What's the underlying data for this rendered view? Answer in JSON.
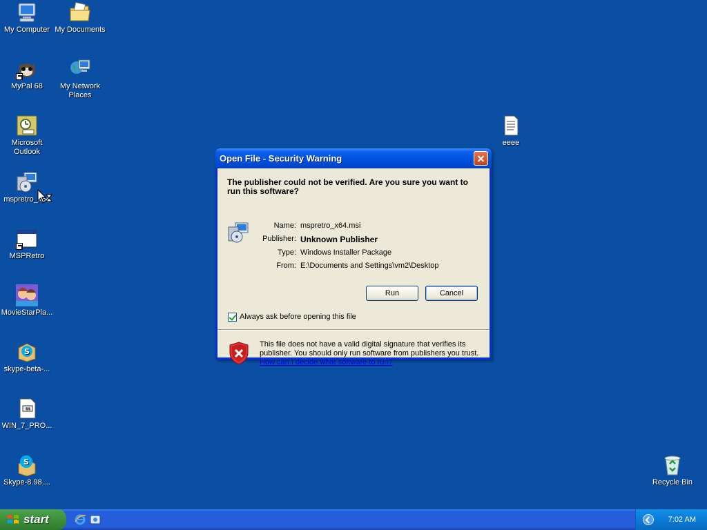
{
  "desktop": {
    "icons": [
      {
        "label": "My Computer",
        "icon": "my-computer-icon"
      },
      {
        "label": "My Documents",
        "icon": "my-documents-icon"
      },
      {
        "label": "MyPal 68",
        "icon": "mypal-icon"
      },
      {
        "label": "My Network Places",
        "icon": "network-places-icon"
      },
      {
        "label": "Microsoft Outlook",
        "icon": "outlook-icon"
      },
      {
        "label": "mspretro_x64",
        "icon": "msi-installer-icon"
      },
      {
        "label": "MSPRetro",
        "icon": "application-icon"
      },
      {
        "label": "MovieStarPla...",
        "icon": "moviestarplanet-icon"
      },
      {
        "label": "skype-beta-...",
        "icon": "skype-installer-icon"
      },
      {
        "label": "WIN_7_PRO...",
        "icon": "iso-file-icon"
      },
      {
        "label": "Skype-8.98....",
        "icon": "skype-installer-icon"
      },
      {
        "label": "eeee",
        "icon": "text-file-icon"
      },
      {
        "label": "Recycle Bin",
        "icon": "recycle-bin-icon"
      }
    ]
  },
  "dialog": {
    "title": "Open File - Security Warning",
    "question": "The publisher could not be verified.  Are you sure you want to run this software?",
    "fields": {
      "name_label": "Name:",
      "name_value": "mspretro_x64.msi",
      "publisher_label": "Publisher:",
      "publisher_value": "Unknown Publisher",
      "type_label": "Type:",
      "type_value": "Windows Installer Package",
      "from_label": "From:",
      "from_value": "E:\\Documents and Settings\\vm2\\Desktop"
    },
    "run_label": "Run",
    "cancel_label": "Cancel",
    "checkbox_label": "Always ask before opening this file",
    "checkbox_checked": true,
    "warning_text": "This file does not have a valid digital signature that verifies its publisher.  You should only run software from publishers you trust.",
    "warning_link": "How can I decide what software to run?"
  },
  "taskbar": {
    "start_label": "start",
    "clock": "7:02 AM",
    "quick_launch": [
      "internet-explorer-icon",
      "show-desktop-icon"
    ]
  },
  "colors": {
    "desktop_bg": "#0a4fa3",
    "titlebar": "#0054e3",
    "dialog_face": "#ece9d8",
    "start_green": "#3c8f3c"
  }
}
